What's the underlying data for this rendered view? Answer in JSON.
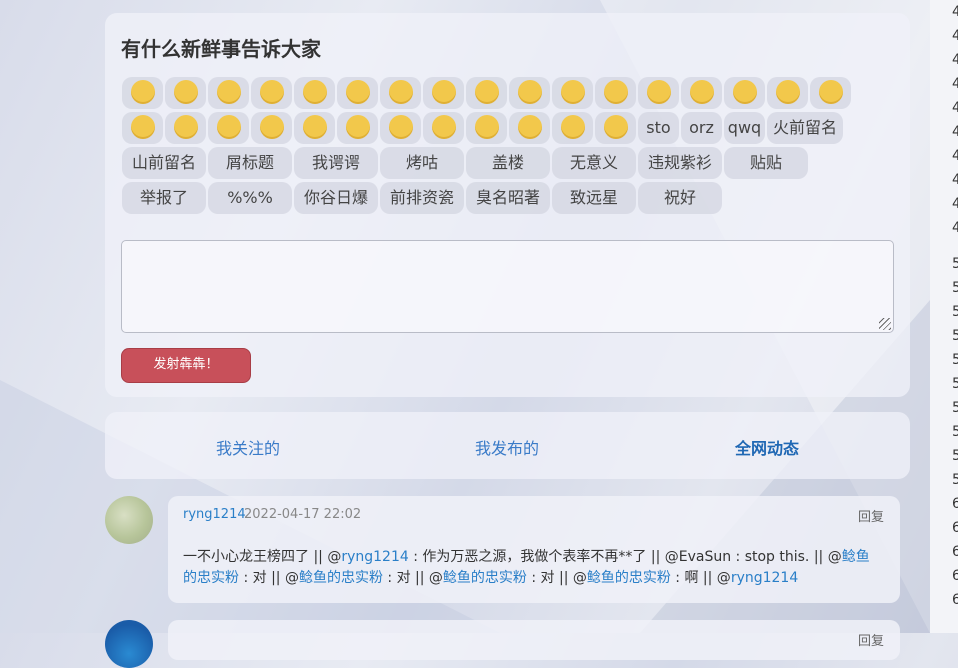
{
  "post": {
    "title": "有什么新鲜事告诉大家",
    "emotes_row1": [
      "sad",
      "angry",
      "heart-eyes",
      "shy",
      "smirk",
      "dizzy",
      "grin",
      "cry",
      "laugh-cry",
      "hammer",
      "thumbs-up",
      "thumbs-down",
      "rose",
      "wilted-rose",
      "ghost",
      "anger-mark",
      "revolver"
    ],
    "emotes_row2_faces": [
      "sob",
      "squint",
      "shock",
      "penguin",
      "knife",
      "cleaver",
      "sleepy",
      "nosebleed",
      "sorry",
      "puppy-eyes",
      "dazed",
      "tearful"
    ],
    "emotes_row2_text": [
      "sto",
      "orz",
      "qwq",
      "火前留名"
    ],
    "emotes_row3": [
      "山前留名",
      "屑标题",
      "我谔谔",
      "烤咕",
      "盖楼",
      "无意义",
      "违规紫衫",
      "贴贴"
    ],
    "emotes_row4": [
      "举报了",
      "%%%",
      "你谷日爆",
      "前排资瓷",
      "臭名昭著",
      "致远星",
      "祝好"
    ],
    "submit_label": "发射犇犇！"
  },
  "tabs": {
    "following": "我关注的",
    "mine": "我发布的",
    "all": "全网动态"
  },
  "comment": {
    "user": "ryng1214",
    "time": "2022-04-17 22:02",
    "reply": "回复",
    "t1": "一不小心龙王榜四了 || @",
    "m1": "ryng1214",
    "t2": " : 作为万恶之源，我做个表率不再**了 || @EvaSun : stop this. || @",
    "m2": "鲶鱼的忠实粉",
    "t3": " : 对 || @",
    "m3": "鲶鱼的忠实粉",
    "t4": " : 对 || @",
    "m4": "鲶鱼的忠实粉",
    "t5": " : 对 || @",
    "m5": "鲶鱼的忠实粉",
    "t6": " : 啊 || @",
    "m6": "ryng1214"
  },
  "comment2": {
    "reply": "回复"
  },
  "right_edge_numbers": [
    "4",
    "4",
    "4",
    "4",
    "4",
    "4",
    "4",
    "4",
    "4",
    "4",
    "5",
    "5",
    "5",
    "5",
    "5",
    "5",
    "5",
    "5",
    "5",
    "5",
    "6",
    "6",
    "6",
    "6",
    "6"
  ]
}
